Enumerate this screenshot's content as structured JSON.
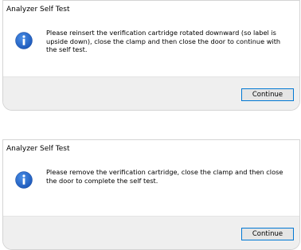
{
  "dialogs": [
    {
      "title": "Analyzer Self Test",
      "icon": "info-icon",
      "message": "Please reinsert the verification cartridge rotated downward (so label is upside down), close the clamp and then close the door to continue with the self test.",
      "button_label": "Continue"
    },
    {
      "title": "Analyzer Self Test",
      "icon": "info-icon",
      "message": "Please remove the verification cartridge, close the clamp and then close the door to complete the self test.",
      "button_label": "Continue"
    }
  ],
  "colors": {
    "info_icon": "#1a56b8",
    "button_border": "#0078d4",
    "footer_background": "#efefef"
  }
}
